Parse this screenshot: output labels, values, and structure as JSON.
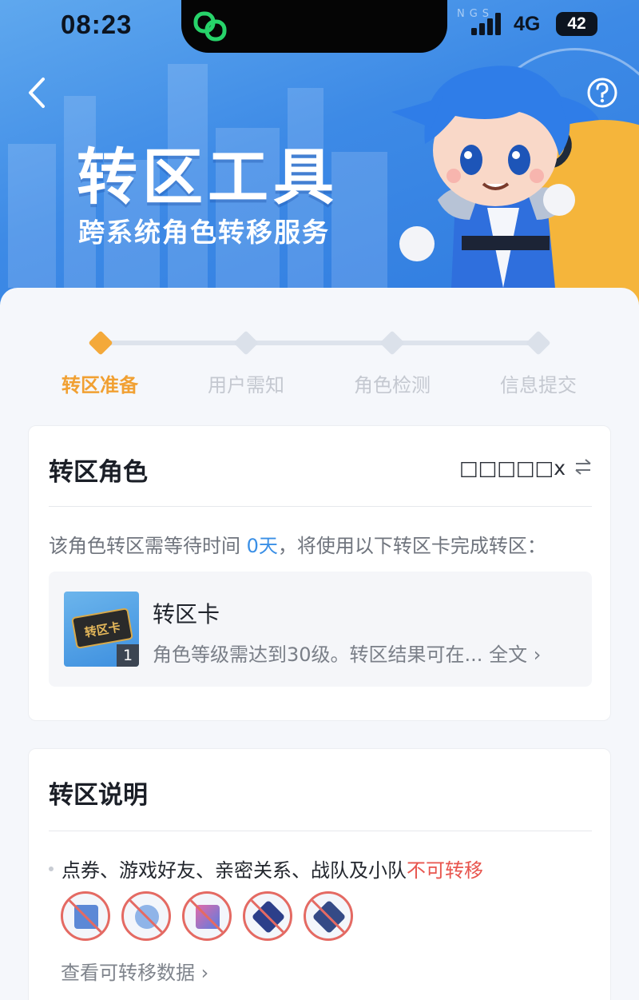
{
  "status_bar": {
    "time": "08:23",
    "network": "4G",
    "battery": "42"
  },
  "hero": {
    "watermark": "NGS",
    "title": "转区工具",
    "subtitle": "跨系统角色转移服务",
    "accent_color": "#3d8ae6"
  },
  "steps": [
    {
      "label": "转区准备",
      "active": true
    },
    {
      "label": "用户需知",
      "active": false
    },
    {
      "label": "角色检测",
      "active": false
    },
    {
      "label": "信息提交",
      "active": false
    }
  ],
  "role_card": {
    "title": "转区角色",
    "role_name": "□□□□□x",
    "switch_icon": "swap-arrows-icon",
    "wait_prefix": "该角色转区需等待时间 ",
    "wait_days": "0天",
    "wait_suffix": "，将使用以下转区卡完成转区：",
    "item": {
      "thumb_text": "转区卡",
      "quantity": "1",
      "title": "转区卡",
      "description": "角色等级需达到30级。转区结果可在...",
      "fulltext_label": "全文"
    }
  },
  "info_card": {
    "title": "转区说明",
    "bullet_text": "点券、游戏好友、亲密关系、战队及小队",
    "bullet_warn": "不可转移",
    "blocked_icons": [
      "coupon-icon",
      "friends-icon",
      "intimacy-icon",
      "team-icon",
      "squad-icon"
    ],
    "view_link": "查看可转移数据"
  }
}
